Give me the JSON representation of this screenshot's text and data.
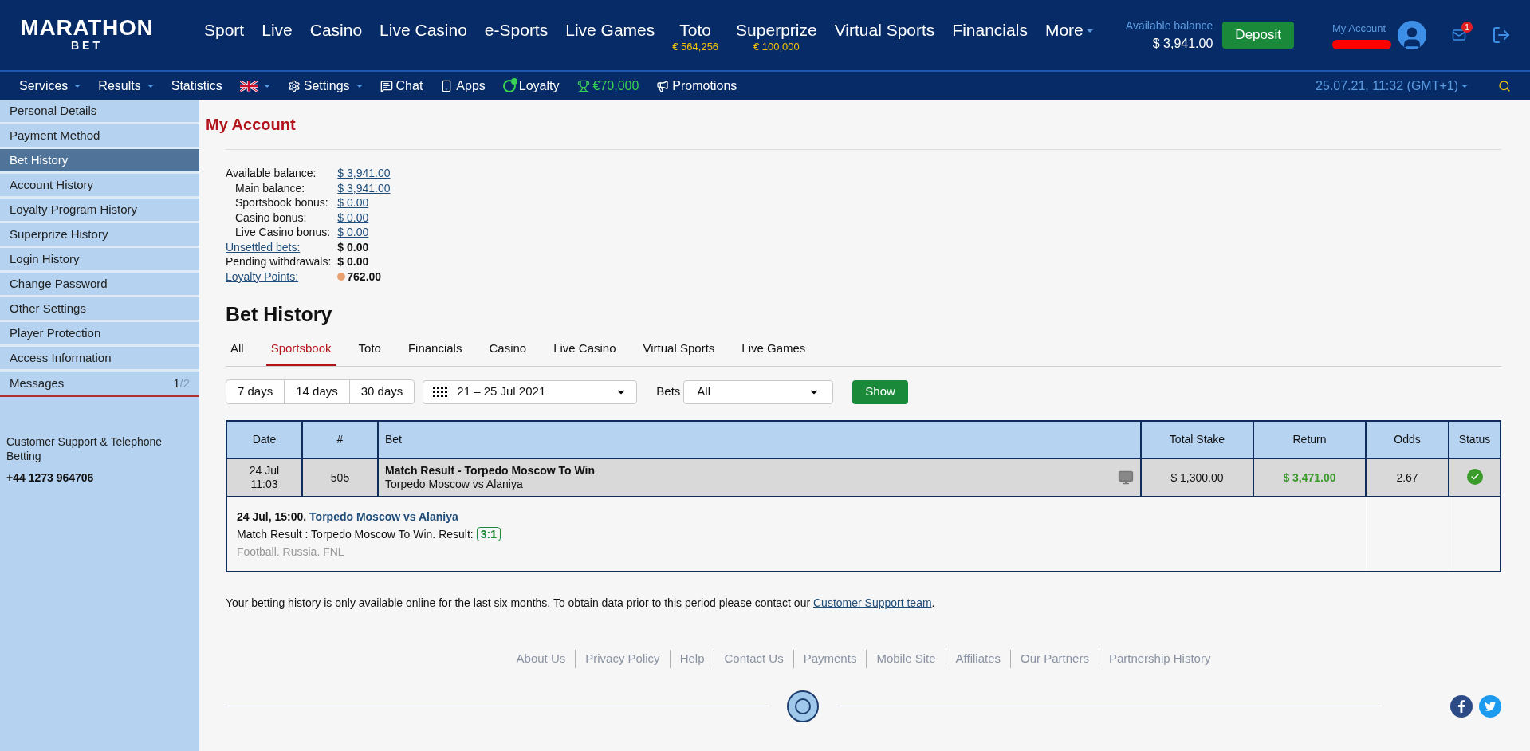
{
  "header": {
    "logo": {
      "line1": "MARATHON",
      "line2": "BET"
    },
    "nav": [
      {
        "label": "Sport"
      },
      {
        "label": "Live"
      },
      {
        "label": "Casino"
      },
      {
        "label": "Live Casino"
      },
      {
        "label": "e-Sports"
      },
      {
        "label": "Live Games"
      },
      {
        "label": "Toto",
        "sub": "€ 564,256"
      },
      {
        "label": "Superprize",
        "sub": "€ 100,000"
      },
      {
        "label": "Virtual Sports"
      },
      {
        "label": "Financials"
      },
      {
        "label": "More",
        "dropdown": true
      }
    ],
    "balance_label": "Available balance",
    "balance": "$ 3,941.00",
    "deposit": "Deposit",
    "account_label": "My Account",
    "notifications": "1"
  },
  "subnav": {
    "items": [
      {
        "kind": "text",
        "label": "Services",
        "dropdown": true
      },
      {
        "kind": "text",
        "label": "Results",
        "dropdown": true
      },
      {
        "kind": "text",
        "label": "Statistics",
        "dropdown": false
      },
      {
        "kind": "flag",
        "dropdown": true
      },
      {
        "kind": "settings",
        "label": "Settings",
        "dropdown": true
      },
      {
        "kind": "chat",
        "label": "Chat",
        "dropdown": false
      },
      {
        "kind": "apps",
        "label": "Apps",
        "dropdown": false
      },
      {
        "kind": "loyalty",
        "label": "Loyalty",
        "dropdown": false
      },
      {
        "kind": "prize",
        "label": "€70,000",
        "dropdown": false
      },
      {
        "kind": "promotions",
        "label": "Promotions",
        "dropdown": false
      }
    ],
    "datetime": "25.07.21, 11:32 (GMT+1)"
  },
  "sidebar": {
    "items": [
      {
        "label": "Personal Details",
        "selected": false
      },
      {
        "label": "Payment Method",
        "selected": false
      },
      {
        "label": "Bet History",
        "selected": true
      },
      {
        "label": "Account History",
        "selected": false
      },
      {
        "label": "Loyalty Program History",
        "selected": false
      },
      {
        "label": "Superprize History",
        "selected": false
      },
      {
        "label": "Login History",
        "selected": false
      },
      {
        "label": "Change Password",
        "selected": false
      },
      {
        "label": "Other Settings",
        "selected": false
      },
      {
        "label": "Player Protection",
        "selected": false
      },
      {
        "label": "Access Information",
        "selected": false
      }
    ],
    "messages": {
      "label": "Messages",
      "unread": "1",
      "total": "/2"
    },
    "support": {
      "text": "Customer Support & Telephone Betting",
      "phone": "+44 1273 964706"
    }
  },
  "account": {
    "title": "My Account",
    "balances": [
      {
        "label": "Available balance:",
        "value": "$ 3,941.00",
        "indented": false,
        "label_link": false,
        "kind": "link"
      },
      {
        "label": "Main balance:",
        "value": "$ 3,941.00",
        "indented": true,
        "label_link": false,
        "kind": "link"
      },
      {
        "label": "Sportsbook bonus:",
        "value": "$ 0.00",
        "indented": true,
        "label_link": false,
        "kind": "link"
      },
      {
        "label": "Casino bonus:",
        "value": "$ 0.00",
        "indented": true,
        "label_link": false,
        "kind": "link"
      },
      {
        "label": "Live Casino bonus:",
        "value": "$ 0.00",
        "indented": true,
        "label_link": false,
        "kind": "link"
      },
      {
        "label": "Unsettled bets:",
        "value": "$ 0.00",
        "indented": false,
        "label_link": true,
        "kind": "bold"
      },
      {
        "label": "Pending withdrawals:",
        "value": "$ 0.00",
        "indented": false,
        "label_link": false,
        "kind": "bold"
      },
      {
        "label": "Loyalty Points:",
        "value": "762.00",
        "indented": false,
        "label_link": true,
        "kind": "points"
      }
    ]
  },
  "bet_history": {
    "title": "Bet History",
    "tabs": [
      {
        "label": "All",
        "selected": false
      },
      {
        "label": "Sportsbook",
        "selected": true
      },
      {
        "label": "Toto",
        "selected": false
      },
      {
        "label": "Financials",
        "selected": false
      },
      {
        "label": "Casino",
        "selected": false
      },
      {
        "label": "Live Casino",
        "selected": false
      },
      {
        "label": "Virtual Sports",
        "selected": false
      },
      {
        "label": "Live Games",
        "selected": false
      }
    ],
    "periods": [
      "7 days",
      "14 days",
      "30 days"
    ],
    "date_range": "21 – 25 Jul 2021",
    "bets_label": "Bets",
    "bets_filter": "All",
    "show": "Show",
    "table": {
      "columns": [
        "Date",
        "#",
        "Bet",
        "Total Stake",
        "Return",
        "Odds",
        "Status"
      ],
      "rows": [
        {
          "date": "24 Jul",
          "time": "11:03",
          "number": "505",
          "market": "Match Result - Torpedo Moscow To Win",
          "event": "Torpedo Moscow vs Alaniya",
          "stake": "$ 1,300.00",
          "return": "$ 3,471.00",
          "odds": "2.67",
          "won": true,
          "detail": {
            "datetime": "24 Jul, 15:00.",
            "event": "Torpedo Moscow vs Alaniya",
            "market": "Match Result : Torpedo Moscow To Win. Result:",
            "score": "3:1",
            "league": "Football. Russia. FNL"
          }
        }
      ]
    },
    "note": {
      "text": "Your betting history is only available online for the last six months. To obtain data prior to this period please contact our ",
      "link": "Customer Support team",
      "end": "."
    }
  },
  "footer": {
    "links": [
      "About Us",
      "Privacy Policy",
      "Help",
      "Contact Us",
      "Payments",
      "Mobile Site",
      "Affiliates",
      "Our Partners",
      "Partnership History"
    ]
  }
}
